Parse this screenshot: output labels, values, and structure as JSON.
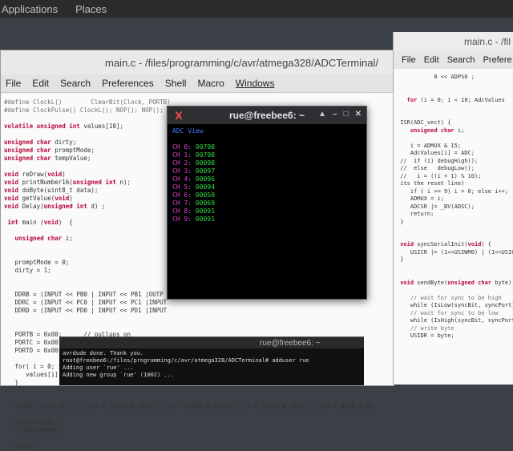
{
  "topbar": {
    "applications": "Applications",
    "places": "Places"
  },
  "left_window": {
    "title": "main.c - /files/programming/c/avr/atmega328/ADCTerminal/",
    "menu": [
      "File",
      "Edit",
      "Search",
      "Preferences",
      "Shell",
      "Macro",
      "Windows"
    ]
  },
  "right_window": {
    "title": "main.c - /fil",
    "menu": [
      "File",
      "Edit",
      "Search",
      "Prefere"
    ]
  },
  "terminal": {
    "title": "rue@freebee6: ~",
    "header": "ADC View",
    "rows": [
      {
        "label": "CH 0:",
        "value": "00798"
      },
      {
        "label": "CH 1:",
        "value": "00798"
      },
      {
        "label": "CH 2:",
        "value": "00098"
      },
      {
        "label": "CH 3:",
        "value": "00097"
      },
      {
        "label": "CH 4:",
        "value": "00096"
      },
      {
        "label": "CH 5:",
        "value": "00094"
      },
      {
        "label": "CH 6:",
        "value": "00050"
      },
      {
        "label": "CH 7:",
        "value": "00069"
      },
      {
        "label": "CH 8:",
        "value": "00091"
      },
      {
        "label": "CH 9:",
        "value": "00091"
      }
    ]
  },
  "bottom_terminal": {
    "title": "rue@freebee6: ~",
    "lines": [
      "avrdude done.  Thank you.",
      "",
      "root@freebee6:/files/programming/c/avr/atmega328/ADCTerminal# adduser rue",
      "Adding user `rue' ...",
      "Adding new group `rue' (1002) ..."
    ]
  },
  "colors": {
    "keyword": "#b80a3a",
    "ch_label": "#d84bd6",
    "ch_value": "#39d849",
    "header": "#3f7bff"
  }
}
